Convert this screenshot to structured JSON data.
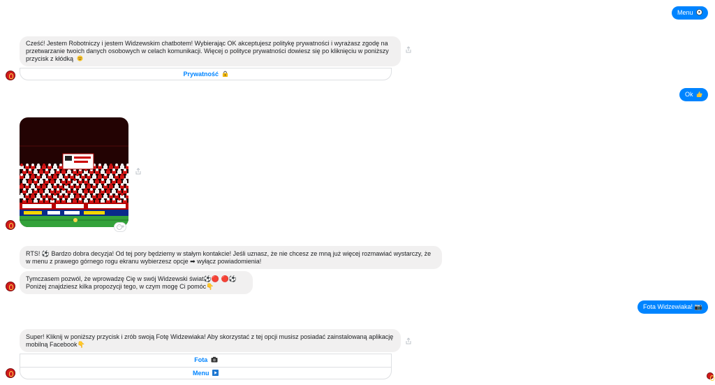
{
  "messages": {
    "menu_out": "Menu",
    "intro_text": "Cześć! Jestem Robotniczy i jestem Widzewskim chatbotem! Wybierając OK akceptujesz politykę prywatności i wyrażasz zgodę na przetwarzanie twoich danych osobowych w celach komunikacji. Więcej o polityce prywatności dowiesz się po kliknięciu w poniższy przycisk z kłódką",
    "privacy_button": "Prywatność",
    "ok_out": "Ok",
    "rts_text": "RTS! ⚽ Bardzo dobra decyzja! Od tej pory będziemy w stałym kontakcie! Jeśli uznasz, że nie chcesz ze mną już więcej rozmawiać wystarczy, że w menu z prawego górnego rogu ekranu wybierzesz opcje ➡ wyłącz powiadomienia!",
    "welcome_line1": "Tymczasem pozwól, że wprowadzę Cię w swój Widzewski świat⚽🔴 🔴⚽",
    "welcome_line2": "Poniżej znajdziesz kilka propozycji tego, w czym mogę Ci pomóc👇",
    "fota_out": "Fota Widzewiaka! 📷",
    "super_text": "Super! Kliknij w poniższy przycisk i zrób swoją Fotę Widzewiaka! Aby skorzystać z tej opcji musisz posiadać zainstalowaną aplikację mobilną Facebook👇",
    "fota_button": "Fota",
    "menu_button": "Menu"
  },
  "colors": {
    "accent": "#0084ff",
    "incoming_bubble": "#f1f0f0",
    "avatar": "#d11a1a"
  },
  "icons": {
    "avatar": "widzew-badge-icon",
    "share": "share-icon",
    "reaction": "add-reaction-icon"
  }
}
